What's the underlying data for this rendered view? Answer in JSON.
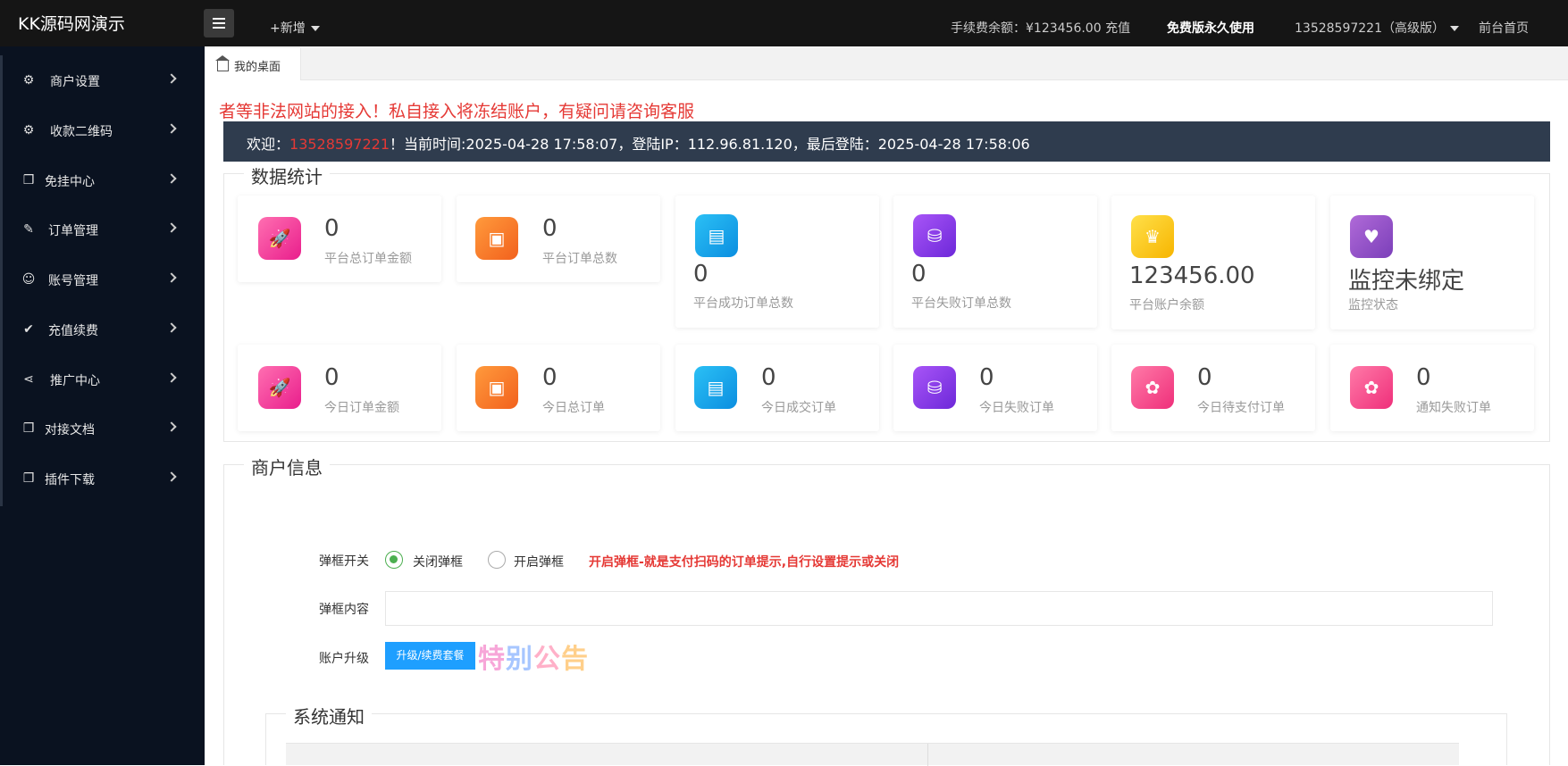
{
  "header": {
    "brand": "KK源码网演示",
    "add_new": "+新增",
    "fee_balance": "手续费余额：¥123456.00 充值",
    "free_version": "免费版永久使用",
    "user": "13528597221（高级版）",
    "home": "前台首页"
  },
  "sidebar": {
    "items": [
      {
        "label": "商户设置",
        "icon": "gear-icon"
      },
      {
        "label": "收款二维码",
        "icon": "gear-icon"
      },
      {
        "label": "免挂中心",
        "icon": "cube-icon"
      },
      {
        "label": "订单管理",
        "icon": "edit-icon"
      },
      {
        "label": "账号管理",
        "icon": "user-icon"
      },
      {
        "label": "充值续费",
        "icon": "check-icon"
      },
      {
        "label": "推广中心",
        "icon": "share-icon"
      },
      {
        "label": "对接文档",
        "icon": "cube-icon"
      },
      {
        "label": "插件下载",
        "icon": "cube-icon"
      }
    ]
  },
  "tabs": [
    {
      "label": "我的桌面",
      "icon": "home-icon"
    }
  ],
  "marquee": "者等非法网站的接入！私自接入将冻结账户，有疑问请咨询客服",
  "welcome": {
    "prefix": "欢迎：",
    "phone": "13528597221",
    "rest": "！当前时间:2025-04-28 17:58:07，登陆IP：112.96.81.120，最后登陆：2025-04-28 17:58:06"
  },
  "stats": {
    "title": "数据统计",
    "row1": [
      {
        "value": "0",
        "label": "平台总订单金额",
        "icon": "rocket-icon",
        "color": "pink"
      },
      {
        "value": "0",
        "label": "平台订单总数",
        "icon": "ticket-icon",
        "color": "orange"
      },
      {
        "value": "0",
        "label": "平台成功订单总数",
        "icon": "card-icon",
        "color": "blue"
      },
      {
        "value": "0",
        "label": "平台失败订单总数",
        "icon": "cylinder-icon",
        "color": "purple"
      },
      {
        "value": "123456.00",
        "label": "平台账户余额",
        "icon": "crown-icon",
        "color": "yellow"
      },
      {
        "value": "监控未绑定",
        "label": "监控状态",
        "icon": "heart-icon",
        "color": "violet"
      }
    ],
    "row2": [
      {
        "value": "0",
        "label": "今日订单金额",
        "icon": "rocket-icon",
        "color": "pink"
      },
      {
        "value": "0",
        "label": "今日总订单",
        "icon": "ticket-icon",
        "color": "orange"
      },
      {
        "value": "0",
        "label": "今日成交订单",
        "icon": "card-icon",
        "color": "blue"
      },
      {
        "value": "0",
        "label": "今日失败订单",
        "icon": "cylinder-icon",
        "color": "purple"
      },
      {
        "value": "0",
        "label": "今日待支付订单",
        "icon": "flame-icon",
        "color": "rose"
      },
      {
        "value": "0",
        "label": "通知失败订单",
        "icon": "flame-icon",
        "color": "rose"
      }
    ]
  },
  "merchant": {
    "title": "商户信息",
    "popup_switch_label": "弹框开关",
    "radio_off": "关闭弹框",
    "radio_on": "开启弹框",
    "popup_hint": "开启弹框-就是支付扫码的订单提示,自行设置提示或关闭",
    "popup_content_label": "弹框内容",
    "popup_content_value": "",
    "upgrade_label": "账户升级",
    "upgrade_button": "升级/续费套餐",
    "special_notice": [
      "特",
      "别",
      "公",
      "告"
    ]
  },
  "system_notice": {
    "title": "系统通知"
  }
}
